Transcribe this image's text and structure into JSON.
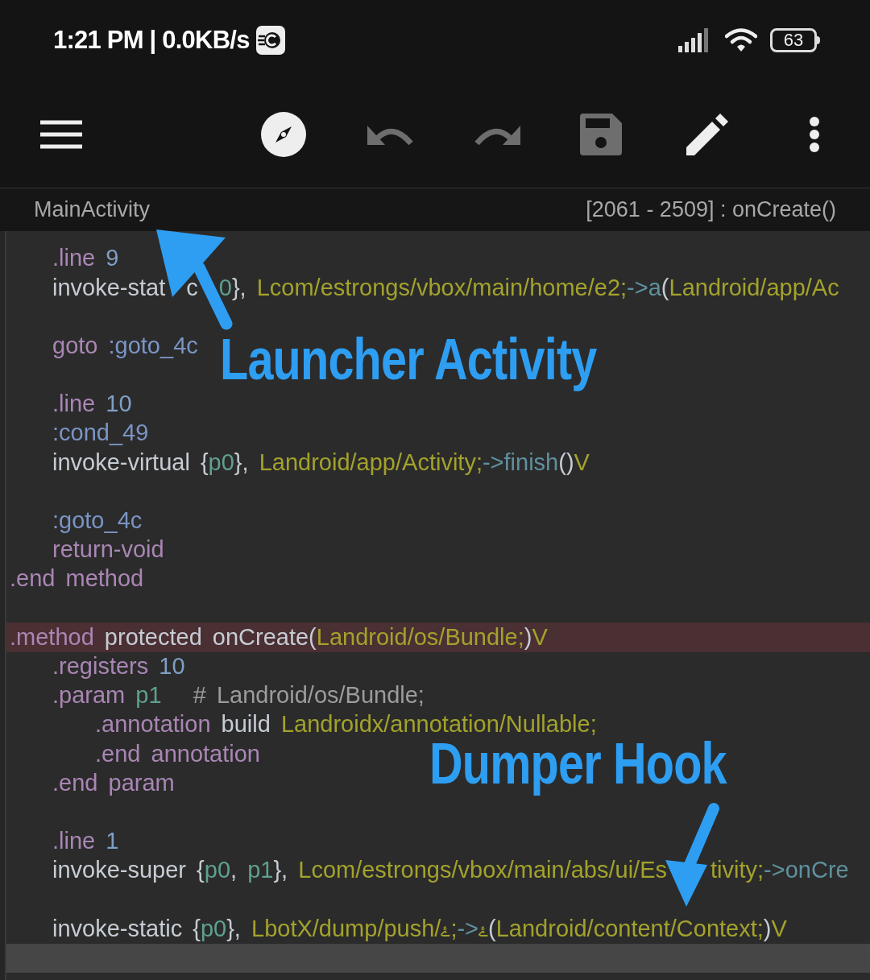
{
  "status_bar": {
    "time": "1:21 PM | 0.0KB/s",
    "battery": "63"
  },
  "toolbar": [
    {
      "disabled": false
    },
    {
      "disabled": false
    },
    {
      "disabled": true
    },
    {
      "disabled": true
    },
    {
      "disabled": true
    },
    {
      "disabled": false
    },
    {
      "disabled": false
    }
  ],
  "header": {
    "class_name": "MainActivity",
    "position": "[2061 - 2509] : onCreate()"
  },
  "code_lines": [
    {
      "kind": "body",
      "marked": false,
      "current": false,
      "tokens": [
        {
          "kind": "d",
          "text": ".line "
        },
        {
          "kind": "n",
          "text": "9"
        }
      ]
    },
    {
      "kind": "body",
      "marked": false,
      "current": false,
      "tokens": [
        {
          "kind": "i",
          "text": "invoke-stat"
        },
        {
          "kind": "gap"
        },
        {
          "kind": "i",
          "text": "c"
        },
        {
          "kind": "gap"
        },
        {
          "kind": "r",
          "text": "0"
        },
        {
          "kind": "p",
          "text": "}, "
        },
        {
          "kind": "t",
          "text": "Lcom/estrongs/vbox/main/home/e2;"
        },
        {
          "kind": "a",
          "text": "->a"
        },
        {
          "kind": "p",
          "text": "("
        },
        {
          "kind": "t",
          "text": "Landroid/app/Ac"
        }
      ]
    },
    {
      "marked": false,
      "current": false
    },
    {
      "kind": "body",
      "marked": false,
      "current": false,
      "tokens": [
        {
          "kind": "d",
          "text": "goto "
        },
        {
          "kind": "l",
          "text": ":goto_4c"
        }
      ]
    },
    {
      "marked": false,
      "current": false
    },
    {
      "kind": "body",
      "marked": false,
      "current": false,
      "tokens": [
        {
          "kind": "d",
          "text": ".line "
        },
        {
          "kind": "n",
          "text": "10"
        }
      ]
    },
    {
      "kind": "body",
      "marked": false,
      "current": false,
      "tokens": [
        {
          "kind": "l",
          "text": ":cond_49"
        }
      ]
    },
    {
      "kind": "body",
      "marked": false,
      "current": false,
      "tokens": [
        {
          "kind": "i",
          "text": "invoke-virtual "
        },
        {
          "kind": "p",
          "text": "{"
        },
        {
          "kind": "r",
          "text": "p0"
        },
        {
          "kind": "p",
          "text": "}, "
        },
        {
          "kind": "t",
          "text": "Landroid/app/Activity;"
        },
        {
          "kind": "a",
          "text": "->finish"
        },
        {
          "kind": "p",
          "text": "()"
        },
        {
          "kind": "t",
          "text": "V"
        }
      ]
    },
    {
      "marked": false,
      "current": false
    },
    {
      "kind": "body",
      "marked": false,
      "current": false,
      "tokens": [
        {
          "kind": "l",
          "text": ":goto_4c"
        }
      ]
    },
    {
      "kind": "body",
      "marked": false,
      "current": false,
      "tokens": [
        {
          "kind": "d",
          "text": "return-void"
        }
      ]
    },
    {
      "kind": "top",
      "marked": false,
      "current": false,
      "tokens": [
        {
          "kind": "d",
          "text": ".end method"
        }
      ]
    },
    {
      "marked": false,
      "current": false
    },
    {
      "kind": "top",
      "marked": true,
      "current": false,
      "tokens": [
        {
          "kind": "d",
          "text": ".method "
        },
        {
          "kind": "i",
          "text": "protected onCreate("
        },
        {
          "kind": "t",
          "text": "Landroid/os/Bundle;"
        },
        {
          "kind": "p",
          "text": ")"
        },
        {
          "kind": "t",
          "text": "V"
        }
      ]
    },
    {
      "kind": "body",
      "marked": false,
      "current": false,
      "tokens": [
        {
          "kind": "d",
          "text": ".registers "
        },
        {
          "kind": "n",
          "text": "10"
        }
      ]
    },
    {
      "kind": "body",
      "marked": false,
      "current": false,
      "tokens": [
        {
          "kind": "d",
          "text": ".param "
        },
        {
          "kind": "r",
          "text": "p1"
        },
        {
          "kind": "c",
          "text": "   # Landroid/os/Bundle;"
        }
      ]
    },
    {
      "kind": "inner",
      "marked": false,
      "current": false,
      "tokens": [
        {
          "kind": "d",
          "text": ".annotation "
        },
        {
          "kind": "i",
          "text": "build "
        },
        {
          "kind": "t",
          "text": "Landroidx/annotation/Nullable;"
        }
      ]
    },
    {
      "kind": "inner",
      "marked": false,
      "current": false,
      "tokens": [
        {
          "kind": "d",
          "text": ".end annotation"
        }
      ]
    },
    {
      "kind": "body",
      "marked": false,
      "current": false,
      "tokens": [
        {
          "kind": "d",
          "text": ".end param"
        }
      ]
    },
    {
      "marked": false,
      "current": false
    },
    {
      "kind": "body",
      "marked": false,
      "current": false,
      "tokens": [
        {
          "kind": "d",
          "text": ".line "
        },
        {
          "kind": "n",
          "text": "1"
        }
      ]
    },
    {
      "kind": "body",
      "marked": false,
      "current": false,
      "tokens": [
        {
          "kind": "i",
          "text": "invoke-super "
        },
        {
          "kind": "p",
          "text": "{"
        },
        {
          "kind": "r",
          "text": "p0"
        },
        {
          "kind": "p",
          "text": ", "
        },
        {
          "kind": "r",
          "text": "p1"
        },
        {
          "kind": "p",
          "text": "}, "
        },
        {
          "kind": "t",
          "text": "Lcom/estrongs/vbox/main/abs/ui/Es"
        },
        {
          "kind": "wide_gap"
        },
        {
          "kind": "t",
          "text": "tivity;"
        },
        {
          "kind": "a",
          "text": "->onCre"
        }
      ]
    },
    {
      "marked": false,
      "current": false
    },
    {
      "kind": "body",
      "marked": false,
      "current": false,
      "tokens": [
        {
          "kind": "i",
          "text": "invoke-static "
        },
        {
          "kind": "p",
          "text": "{"
        },
        {
          "kind": "r",
          "text": "p0"
        },
        {
          "kind": "p",
          "text": "}, "
        },
        {
          "kind": "t",
          "text": "LbotX/dump/push/"
        },
        {
          "kind": "g",
          "text": "ۓ"
        },
        {
          "kind": "t",
          "text": ";"
        },
        {
          "kind": "a",
          "text": "->"
        },
        {
          "kind": "g",
          "text": "ۓ"
        },
        {
          "kind": "p",
          "text": "("
        },
        {
          "kind": "t",
          "text": "Landroid/content/Context;"
        },
        {
          "kind": "p",
          "text": ")"
        },
        {
          "kind": "t",
          "text": "V"
        }
      ]
    },
    {
      "marked": false,
      "current": true
    }
  ],
  "callouts": [
    {
      "text": "Launcher Activity",
      "kind": "up"
    },
    {
      "text": "Dumper Hook",
      "kind": "down"
    }
  ]
}
